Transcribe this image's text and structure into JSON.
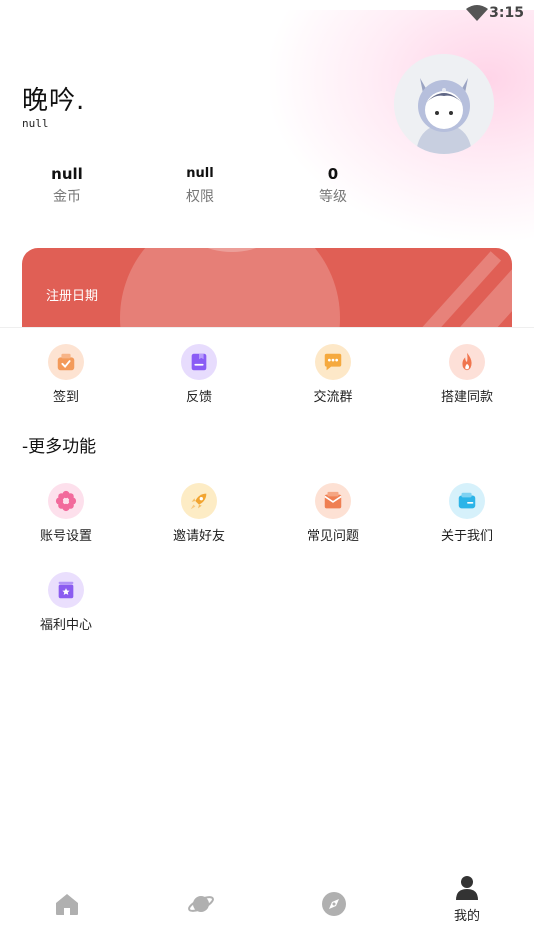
{
  "status_bar": {
    "time": "3:15"
  },
  "profile": {
    "name": "晚吟.",
    "subtitle": "null"
  },
  "stats": [
    {
      "value": "null",
      "label": "金币"
    },
    {
      "value": "null",
      "label": "权限"
    },
    {
      "value": "0",
      "label": "等级"
    }
  ],
  "card": {
    "label": "注册日期",
    "color": "#e05f55"
  },
  "quick_actions": [
    {
      "label": "签到",
      "icon": "checkin-icon"
    },
    {
      "label": "反馈",
      "icon": "feedback-icon"
    },
    {
      "label": "交流群",
      "icon": "chat-group-icon"
    },
    {
      "label": "搭建同款",
      "icon": "fire-icon"
    }
  ],
  "more_section": {
    "title": "-更多功能",
    "items": [
      {
        "label": "账号设置",
        "icon": "gear-flower-icon"
      },
      {
        "label": "邀请好友",
        "icon": "rocket-icon"
      },
      {
        "label": "常见问题",
        "icon": "mail-icon"
      },
      {
        "label": "关于我们",
        "icon": "wallet-icon"
      },
      {
        "label": "福利中心",
        "icon": "star-box-icon"
      }
    ]
  },
  "bottom_nav": [
    {
      "icon": "home-icon",
      "label": ""
    },
    {
      "icon": "planet-icon",
      "label": ""
    },
    {
      "icon": "compass-icon",
      "label": ""
    },
    {
      "icon": "user-icon",
      "label": "我的",
      "active": true
    }
  ]
}
